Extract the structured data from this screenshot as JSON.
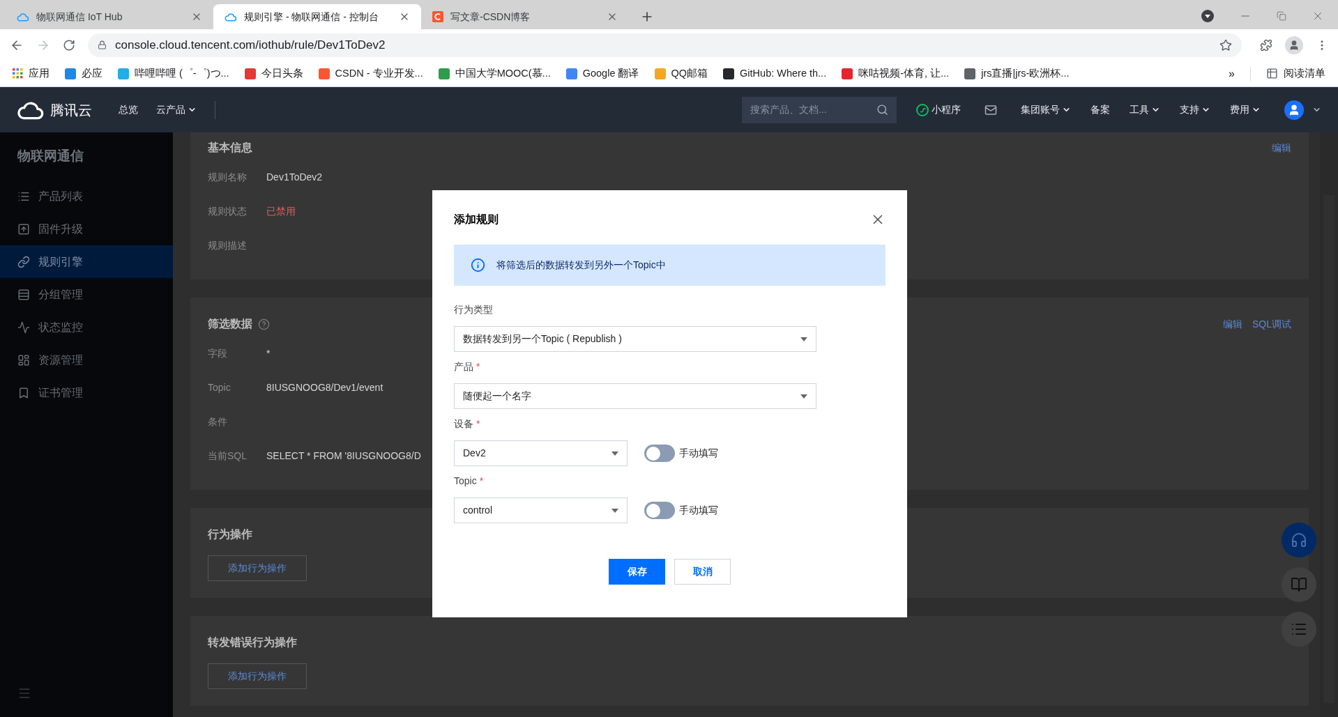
{
  "browser": {
    "tabs": [
      {
        "title": "物联网通信 IoT Hub",
        "selected": false,
        "kind": "cloud"
      },
      {
        "title": "规则引擎 - 物联网通信 - 控制台",
        "selected": true,
        "kind": "cloud"
      },
      {
        "title": "写文章-CSDN博客",
        "selected": false,
        "kind": "letter"
      }
    ],
    "url": "console.cloud.tencent.com/iothub/rule/Dev1ToDev2",
    "bookmarks": [
      {
        "label": "应用",
        "kind": "apps"
      },
      {
        "label": "必应",
        "kind": "site",
        "color": "#1e88e5"
      },
      {
        "label": "哔哩哔哩 (゜-゜)つ...",
        "kind": "site",
        "color": "#23ade5"
      },
      {
        "label": "今日头条",
        "kind": "site",
        "color": "#e53935"
      },
      {
        "label": "CSDN - 专业开发...",
        "kind": "site",
        "color": "#fc5531"
      },
      {
        "label": "中国大学MOOC(慕...",
        "kind": "site",
        "color": "#2e9c4a"
      },
      {
        "label": "Google 翻译",
        "kind": "site",
        "color": "#4285f4"
      },
      {
        "label": "QQ邮箱",
        "kind": "site",
        "color": "#f5a623"
      },
      {
        "label": "GitHub: Where th...",
        "kind": "site",
        "color": "#24292e"
      },
      {
        "label": "咪咕视频-体育, 让...",
        "kind": "site",
        "color": "#e3262d"
      },
      {
        "label": "jrs直播|jrs-欧洲杯...",
        "kind": "site",
        "color": "#5f6368"
      }
    ],
    "overflow": "»",
    "reading_list": "阅读清单"
  },
  "nav": {
    "logo": "腾讯云",
    "links": [
      {
        "label": "总览",
        "dropdown": false
      },
      {
        "label": "云产品",
        "dropdown": true
      }
    ],
    "search_placeholder": "搜索产品、文档...",
    "mini_program": "小程序",
    "items": [
      {
        "label": "集团账号",
        "dropdown": true
      },
      {
        "label": "备案",
        "dropdown": false
      },
      {
        "label": "工具",
        "dropdown": true
      },
      {
        "label": "支持",
        "dropdown": true
      },
      {
        "label": "费用",
        "dropdown": true
      }
    ]
  },
  "sidebar": {
    "title": "物联网通信",
    "items": [
      {
        "label": "产品列表",
        "selected": false
      },
      {
        "label": "固件升级",
        "selected": false
      },
      {
        "label": "规则引擎",
        "selected": true
      },
      {
        "label": "分组管理",
        "selected": false
      },
      {
        "label": "状态监控",
        "selected": false
      },
      {
        "label": "资源管理",
        "selected": false
      },
      {
        "label": "证书管理",
        "selected": false
      }
    ]
  },
  "sections": [
    {
      "title": "基本信息",
      "help": false,
      "links": [
        "编辑"
      ],
      "fields": [
        {
          "label": "规则名称",
          "value": "Dev1ToDev2",
          "kind": "text"
        },
        {
          "label": "规则状态",
          "value": "已禁用",
          "kind": "danger"
        },
        {
          "label": "规则描述"
        }
      ]
    },
    {
      "title": "筛选数据",
      "help": true,
      "links": [
        "编辑",
        "SQL调试"
      ],
      "fields": [
        {
          "label": "字段",
          "value": "*",
          "kind": "text"
        },
        {
          "label": "Topic",
          "value": "8IUSGNOOG8/Dev1/event",
          "kind": "text"
        },
        {
          "label": "条件"
        },
        {
          "label": "当前SQL",
          "value": "SELECT * FROM '8IUSGNOOG8/D",
          "kind": "text"
        }
      ]
    },
    {
      "title": "行为操作",
      "help": false,
      "button": "添加行为操作"
    },
    {
      "title": "转发错误行为操作",
      "help": false,
      "button": "添加行为操作"
    }
  ],
  "modal": {
    "title": "添加规则",
    "notice": "将筛选后的数据转发到另外一个Topic中",
    "fields": [
      {
        "label": "行为类型",
        "required": false,
        "value": "数据转发到另一个Topic ( Republish )",
        "wide": true
      },
      {
        "label": "产品",
        "required": true,
        "value": "随便起一个名字",
        "wide": true
      },
      {
        "label": "设备",
        "required": true,
        "value": "Dev2",
        "wide": false,
        "toggle": {
          "label": "手动填写",
          "on": false
        }
      },
      {
        "label": "Topic",
        "required": true,
        "value": "control",
        "wide": false,
        "toggle": {
          "label": "手动填写",
          "on": false
        }
      }
    ],
    "save": "保存",
    "cancel": "取消"
  }
}
